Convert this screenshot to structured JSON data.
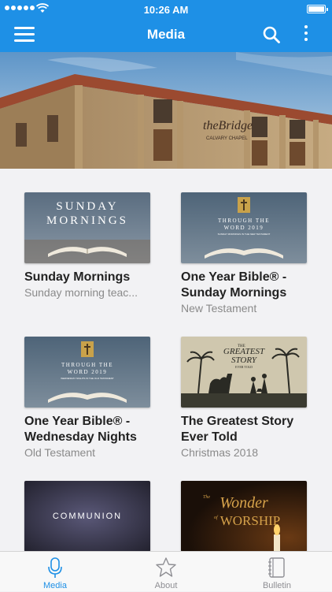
{
  "status_bar": {
    "time": "10:26 AM"
  },
  "header": {
    "title": "Media"
  },
  "hero": {
    "sign_line1": "theBridge",
    "sign_line2": "CALVARY CHAPEL"
  },
  "media_items": [
    {
      "title": "Sunday Mornings",
      "subtitle": "Sunday morning teac...",
      "thumb_line1": "SUNDAY",
      "thumb_line2": "MORNINGS"
    },
    {
      "title": "One Year Bible® - Sunday Mornings",
      "subtitle": "New Testament",
      "thumb_line1": "THROUGH THE",
      "thumb_line2": "WORD 2019",
      "thumb_line3": "SUNDAY MORNINGS IN THE NEW TESTAMENT"
    },
    {
      "title": "One Year Bible® - Wednesday Nights",
      "subtitle": "Old Testament",
      "thumb_line1": "THROUGH THE",
      "thumb_line2": "WORD 2019",
      "thumb_line3": "WEDNESDAY NIGHTS IN THE OLD TESTAMENT"
    },
    {
      "title": "The Greatest Story Ever Told",
      "subtitle": "Christmas 2018",
      "thumb_line1": "GREATEST",
      "thumb_line2": "STORY",
      "thumb_line3": "EVER TOLD",
      "thumb_prefix": "THE"
    },
    {
      "title": "",
      "subtitle": "",
      "thumb_line1": "COMMUNION"
    },
    {
      "title": "",
      "subtitle": "",
      "thumb_line1": "Wonder",
      "thumb_line2": "WORSHIP",
      "thumb_prefix": "The",
      "thumb_of": "of"
    }
  ],
  "tabs": [
    {
      "label": "Media",
      "icon": "microphone-icon",
      "active": true
    },
    {
      "label": "About",
      "icon": "star-icon",
      "active": false
    },
    {
      "label": "Bulletin",
      "icon": "notebook-icon",
      "active": false
    }
  ],
  "colors": {
    "accent": "#1e90e6"
  }
}
